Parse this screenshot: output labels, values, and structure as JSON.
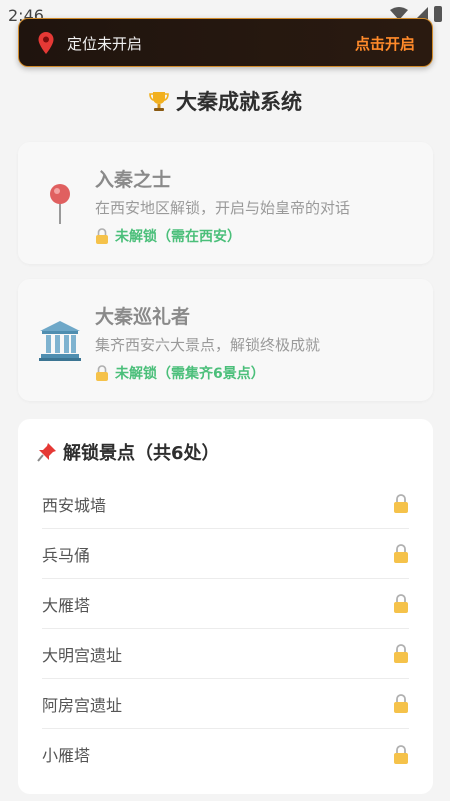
{
  "status_bar": {
    "time": "2:46"
  },
  "banner": {
    "message": "定位未开启",
    "action": "点击开启",
    "icon": "map-pin-icon"
  },
  "page": {
    "title": "大秦成就系统",
    "title_icon": "trophy-icon"
  },
  "achievements": [
    {
      "name": "入秦之士",
      "desc": "在西安地区解锁，开启与始皇帝的对话",
      "status": "未解锁（需在西安）",
      "icon": "map-pin-icon"
    },
    {
      "name": "大秦巡礼者",
      "desc": "集齐西安六大景点，解锁终极成就",
      "status": "未解锁（需集齐6景点）",
      "icon": "classical-building-icon"
    }
  ],
  "spots": {
    "header": "解锁景点（共6处）",
    "items": [
      {
        "label": "西安城墙",
        "locked": true
      },
      {
        "label": "兵马俑",
        "locked": true
      },
      {
        "label": "大雁塔",
        "locked": true
      },
      {
        "label": "大明宫遗址",
        "locked": true
      },
      {
        "label": "阿房宫遗址",
        "locked": true
      },
      {
        "label": "小雁塔",
        "locked": true
      }
    ]
  },
  "colors": {
    "accent": "#ff8a2a",
    "unlocked_text": "#4bbf7a",
    "banner_bg": "#1f140e",
    "lock": "#f5c24a"
  }
}
